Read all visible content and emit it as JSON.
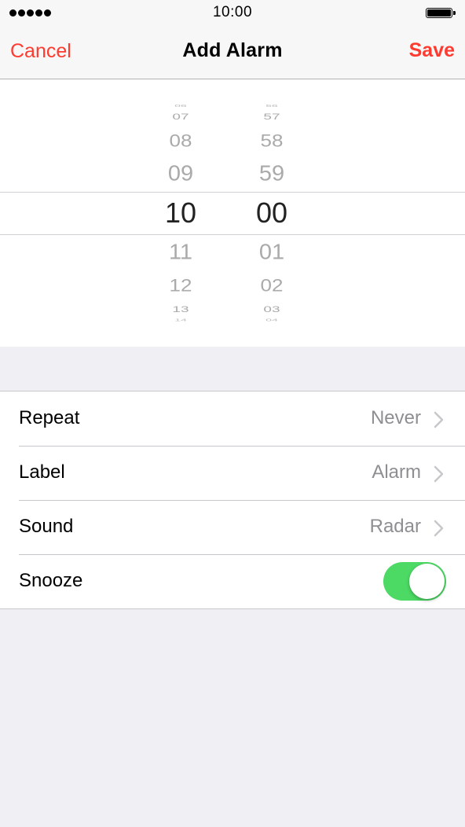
{
  "status_bar": {
    "signal_dots": 5,
    "time": "10:00",
    "battery_level": 1.0
  },
  "nav": {
    "cancel_label": "Cancel",
    "title": "Add Alarm",
    "save_label": "Save",
    "accent_color": "#ff3b30"
  },
  "time_picker": {
    "hours": [
      "06",
      "07",
      "08",
      "09",
      "10",
      "11",
      "12",
      "13",
      "14"
    ],
    "minutes": [
      "56",
      "57",
      "58",
      "59",
      "00",
      "01",
      "02",
      "03",
      "04"
    ],
    "selected_hour": "10",
    "selected_minute": "00"
  },
  "settings": {
    "repeat": {
      "label": "Repeat",
      "value": "Never",
      "icon": "chevron-right-icon"
    },
    "label": {
      "label": "Label",
      "value": "Alarm",
      "icon": "chevron-right-icon"
    },
    "sound": {
      "label": "Sound",
      "value": "Radar",
      "icon": "chevron-right-icon"
    },
    "snooze": {
      "label": "Snooze",
      "enabled": true,
      "toggle_color": "#4cd964"
    }
  }
}
